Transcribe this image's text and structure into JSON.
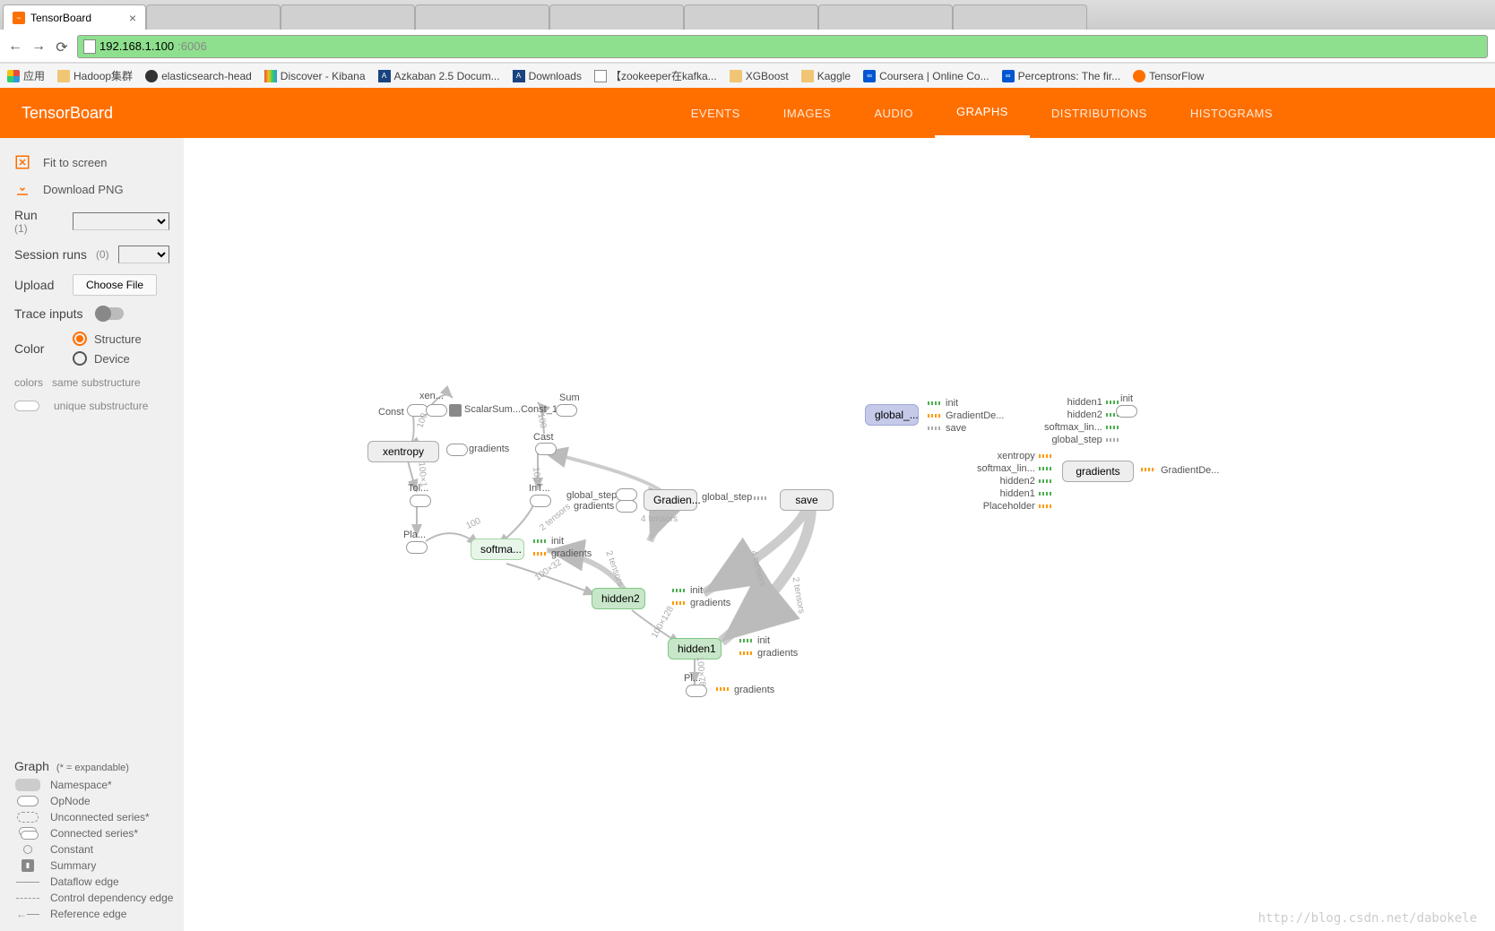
{
  "browser": {
    "tab_title": "TensorBoard",
    "url_host": "192.168.1.100",
    "url_port": ":6006",
    "bookmarks": {
      "apps": "应用",
      "hadoop": "Hadoop集群",
      "es": "elasticsearch-head",
      "kibana": "Discover - Kibana",
      "azkaban": "Azkaban 2.5 Docum...",
      "downloads": "Downloads",
      "zookeeper": "【zookeeper在kafka...",
      "xgboost": "XGBoost",
      "kaggle": "Kaggle",
      "coursera": "Coursera | Online Co...",
      "perceptrons": "Perceptrons: The fir...",
      "tensorflow": "TensorFlow"
    }
  },
  "header": {
    "title": "TensorBoard",
    "nav": {
      "events": "EVENTS",
      "images": "IMAGES",
      "audio": "AUDIO",
      "graphs": "GRAPHS",
      "distributions": "DISTRIBUTIONS",
      "histograms": "HISTOGRAMS"
    }
  },
  "sidebar": {
    "fit": "Fit to screen",
    "download": "Download PNG",
    "run_label": "Run",
    "run_count": "(1)",
    "session_label": "Session runs",
    "session_count": "(0)",
    "upload_label": "Upload",
    "choose_file": "Choose File",
    "trace_label": "Trace inputs",
    "color_label": "Color",
    "color_structure": "Structure",
    "color_device": "Device",
    "colors_label": "colors",
    "same_sub": "same substructure",
    "unique_sub": "unique substructure"
  },
  "legend": {
    "title": "Graph",
    "hint": "(* = expandable)",
    "namespace": "Namespace*",
    "opnode": "OpNode",
    "unconnected": "Unconnected series*",
    "connected": "Connected series*",
    "constant": "Constant",
    "summary": "Summary",
    "dataflow": "Dataflow edge",
    "control": "Control dependency edge",
    "reference": "Reference edge"
  },
  "graph": {
    "const": "Const",
    "xen": "xen...",
    "sum": "Sum",
    "scalarsum": "ScalarSum...Const_1",
    "xentropy": "xentropy",
    "gradients": "gradients",
    "cast": "Cast",
    "tol": "Tol...",
    "int": "InT...",
    "pla": "Pla...",
    "softma": "softma...",
    "global_step_txt": "global_step",
    "gradients_txt": "gradients",
    "two_tensors": "2 tensors",
    "four_tensors": "4 tensors",
    "gradien": "Gradien...",
    "global_step": "global_step",
    "save": "save",
    "hidden2": "hidden2",
    "hidden1": "hidden1",
    "init": "init",
    "pl2": "Pl...",
    "global_aux": "global_...",
    "gradientde_aux": "GradientDe...",
    "save_aux": "save",
    "hidden1_aux": "hidden1",
    "hidden2_aux": "hidden2",
    "softmax_lin": "softmax_lin...",
    "global_step_aux": "global_step",
    "xentropy_aux": "xentropy",
    "placeholder_aux": "Placeholder",
    "gradients_big": "gradients",
    "gradientde2": "GradientDe...",
    "t100": "100",
    "t100x1": "100×1",
    "t100x32": "100×32",
    "t100x128": "100×128",
    "t100x10": "100×10",
    "t100x78": "100×78"
  },
  "watermark": "http://blog.csdn.net/dabokele"
}
